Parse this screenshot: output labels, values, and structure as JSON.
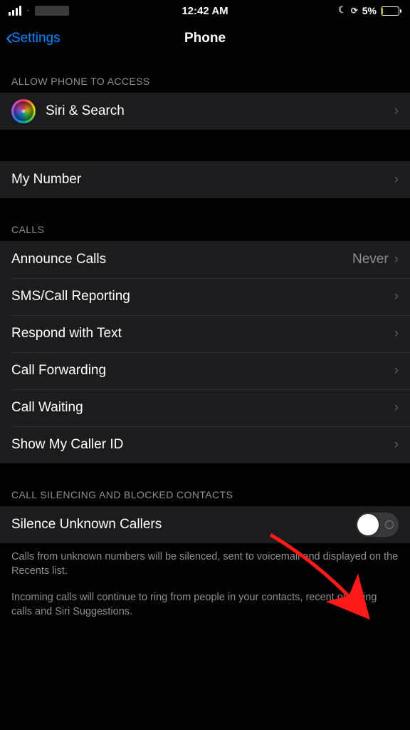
{
  "status": {
    "time": "12:42 AM",
    "battery_percent": "5%"
  },
  "nav": {
    "back_label": "Settings",
    "title": "Phone"
  },
  "sections": {
    "access": {
      "header": "Allow Phone to Access",
      "siri_search": "Siri & Search"
    },
    "my_number": {
      "label": "My Number"
    },
    "calls": {
      "header": "Calls",
      "announce_calls": {
        "label": "Announce Calls",
        "value": "Never"
      },
      "sms_reporting": "SMS/Call Reporting",
      "respond_text": "Respond with Text",
      "call_forwarding": "Call Forwarding",
      "call_waiting": "Call Waiting",
      "show_caller_id": "Show My Caller ID"
    },
    "silencing": {
      "header": "Call Silencing and Blocked Contacts",
      "silence_unknown": "Silence Unknown Callers",
      "footer1": "Calls from unknown numbers will be silenced, sent to voicemail and displayed on the Recents list.",
      "footer2": "Incoming calls will continue to ring from people in your contacts, recent outgoing calls and Siri Suggestions."
    }
  }
}
